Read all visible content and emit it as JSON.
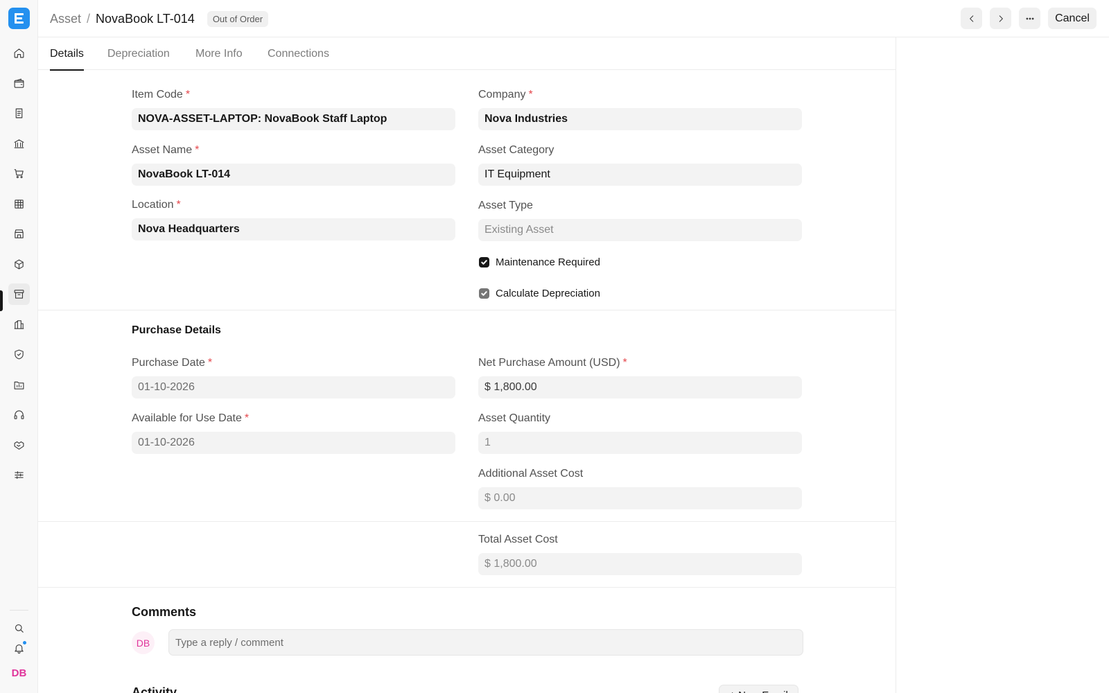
{
  "app": {
    "logo_letter": "E"
  },
  "breadcrumb": {
    "parent": "Asset",
    "separator": "/",
    "current": "NovaBook LT-014",
    "status": "Out of Order"
  },
  "header": {
    "cancel_label": "Cancel"
  },
  "tabs": [
    {
      "label": "Details"
    },
    {
      "label": "Depreciation"
    },
    {
      "label": "More Info"
    },
    {
      "label": "Connections"
    }
  ],
  "form": {
    "item_code": {
      "label": "Item Code",
      "required": "*",
      "value": "NOVA-ASSET-LAPTOP: NovaBook Staff Laptop"
    },
    "company": {
      "label": "Company",
      "required": "*",
      "value": "Nova Industries"
    },
    "asset_name": {
      "label": "Asset Name",
      "required": "*",
      "value": "NovaBook LT-014"
    },
    "asset_category": {
      "label": "Asset Category",
      "value": "IT Equipment"
    },
    "location": {
      "label": "Location",
      "required": "*",
      "value": "Nova Headquarters"
    },
    "asset_type": {
      "label": "Asset Type",
      "value": "Existing Asset"
    },
    "maintenance_required": {
      "label": "Maintenance Required",
      "checked": true
    },
    "calculate_depreciation": {
      "label": "Calculate Depreciation",
      "checked": true
    }
  },
  "purchase": {
    "section_title": "Purchase Details",
    "purchase_date": {
      "label": "Purchase Date",
      "required": "*",
      "value": "01-10-2026"
    },
    "net_purchase_amount": {
      "label": "Net Purchase Amount (USD)",
      "required": "*",
      "value": "$ 1,800.00"
    },
    "available_for_use_date": {
      "label": "Available for Use Date",
      "required": "*",
      "value": "01-10-2026"
    },
    "asset_quantity": {
      "label": "Asset Quantity",
      "value": "1"
    },
    "additional_asset_cost": {
      "label": "Additional Asset Cost",
      "value": "$ 0.00"
    }
  },
  "totals": {
    "total_asset_cost": {
      "label": "Total Asset Cost",
      "value": "$ 1,800.00"
    }
  },
  "comments": {
    "title": "Comments",
    "avatar_initials": "DB",
    "placeholder": "Type a reply / comment"
  },
  "activity": {
    "title": "Activity",
    "new_email_label": "+ New Email"
  },
  "sidebar": {
    "user_initials": "DB",
    "icons": [
      "home-icon",
      "wallet-icon",
      "receipt-icon",
      "bank-icon",
      "cart-icon",
      "table-icon",
      "store-icon",
      "package-icon",
      "archive-icon",
      "building-icon",
      "shield-icon",
      "folder-icon",
      "headset-icon",
      "handshake-icon",
      "sliders-icon",
      "search-icon",
      "bell-icon"
    ]
  },
  "colors": {
    "accent": "#2490ef",
    "required": "#e5484d",
    "avatar": "#e0359b"
  }
}
